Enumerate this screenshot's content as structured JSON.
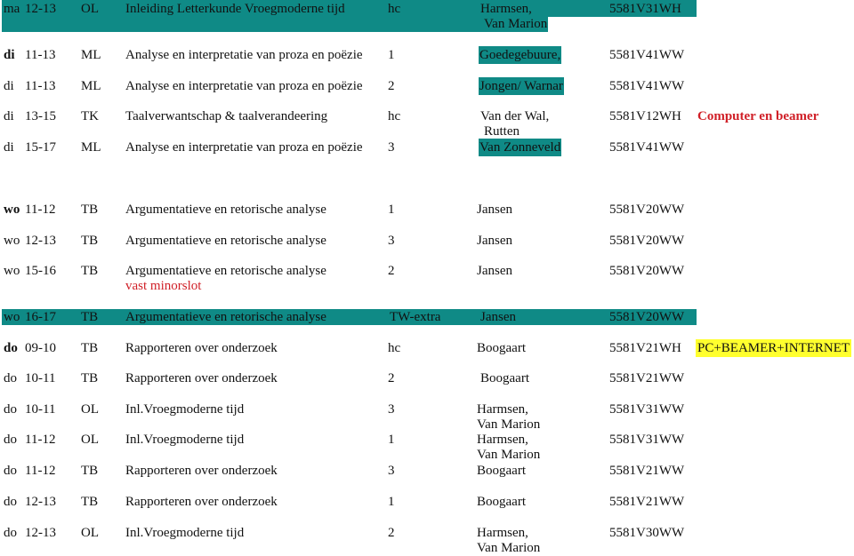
{
  "colors": {
    "teal_highlight": "#0f8a86",
    "red_text": "#d01f27",
    "yellow_highlight": "#ffff2e"
  },
  "rows": [
    {
      "day": "ma",
      "time": "12-13",
      "code": "OL",
      "title": "Inleiding Letterkunde Vroegmoderne tijd",
      "group": "hc",
      "teacher": "Harmsen,",
      "teacher2": "Van Marion",
      "room": "5581V31WH"
    },
    {
      "day": "di",
      "time": "11-13",
      "code": "ML",
      "title": "Analyse en interpretatie van proza en poëzie",
      "group": "1",
      "teacher": "Goedegebuure,",
      "room": "5581V41WW"
    },
    {
      "day": "di",
      "time": "11-13",
      "code": "ML",
      "title": "Analyse en interpretatie van proza en poëzie",
      "group": "2",
      "teacher": "Jongen/ Warnar",
      "room": "5581V41WW"
    },
    {
      "day": "di",
      "time": "13-15",
      "code": "TK",
      "title": "Taalverwantschap & taalverandeering",
      "group": "hc",
      "teacher": "Van der Wal,",
      "teacher2": "Rutten",
      "room": "5581V12WH",
      "note": "Computer en beamer"
    },
    {
      "day": "di",
      "time": "15-17",
      "code": "ML",
      "title": "Analyse en interpretatie van proza en poëzie",
      "group": "3",
      "teacher": "Van Zonneveld",
      "room": "5581V41WW"
    },
    {
      "day": "wo",
      "time": "11-12",
      "code": "TB",
      "title": "Argumentatieve en retorische analyse",
      "group": "1",
      "teacher": "Jansen",
      "room": "5581V20WW"
    },
    {
      "day": "wo",
      "time": "12-13",
      "code": "TB",
      "title": "Argumentatieve en retorische analyse",
      "group": "3",
      "teacher": "Jansen",
      "room": "5581V20WW"
    },
    {
      "day": "wo",
      "time": "15-16",
      "code": "TB",
      "title": "Argumentatieve en retorische analyse",
      "title_note": "vast minorslot",
      "group": "2",
      "teacher": "Jansen",
      "room": "5581V20WW"
    },
    {
      "day": "wo",
      "time": "16-17",
      "code": "TB",
      "title": "Argumentatieve en retorische analyse",
      "group": "TW-extra",
      "teacher": "Jansen",
      "room": "5581V20WW"
    },
    {
      "day": "do",
      "time": "09-10",
      "code": "TB",
      "title": "Rapporteren over onderzoek",
      "group": "hc",
      "teacher": "Boogaart",
      "room": "5581V21WH",
      "note": "PC+BEAMER+INTERNET"
    },
    {
      "day": "do",
      "time": "10-11",
      "code": "TB",
      "title": "Rapporteren over onderzoek",
      "group": "2",
      "teacher": "Boogaart",
      "room": "5581V21WW"
    },
    {
      "day": "do",
      "time": "10-11",
      "code": "OL",
      "title": "Inl.Vroegmoderne tijd",
      "group": "3",
      "teacher": "Harmsen,",
      "teacher2": "Van Marion",
      "room": "5581V31WW"
    },
    {
      "day": "do",
      "time": "11-12",
      "code": "OL",
      "title": "Inl.Vroegmoderne tijd",
      "group": "1",
      "teacher": "Harmsen,",
      "teacher2": "Van Marion",
      "room": "5581V31WW"
    },
    {
      "day": "do",
      "time": "11-12",
      "code": "TB",
      "title": "Rapporteren over onderzoek",
      "group": "3",
      "teacher": "Boogaart",
      "room": "5581V21WW"
    },
    {
      "day": "do",
      "time": "12-13",
      "code": "TB",
      "title": "Rapporteren over onderzoek",
      "group": "1",
      "teacher": "Boogaart",
      "room": "5581V21WW"
    },
    {
      "day": "do",
      "time": "12-13",
      "code": "OL",
      "title": "Inl.Vroegmoderne tijd",
      "group": "2",
      "teacher": "Harmsen,",
      "teacher2": "Van Marion",
      "room": "5581V30WW"
    }
  ]
}
